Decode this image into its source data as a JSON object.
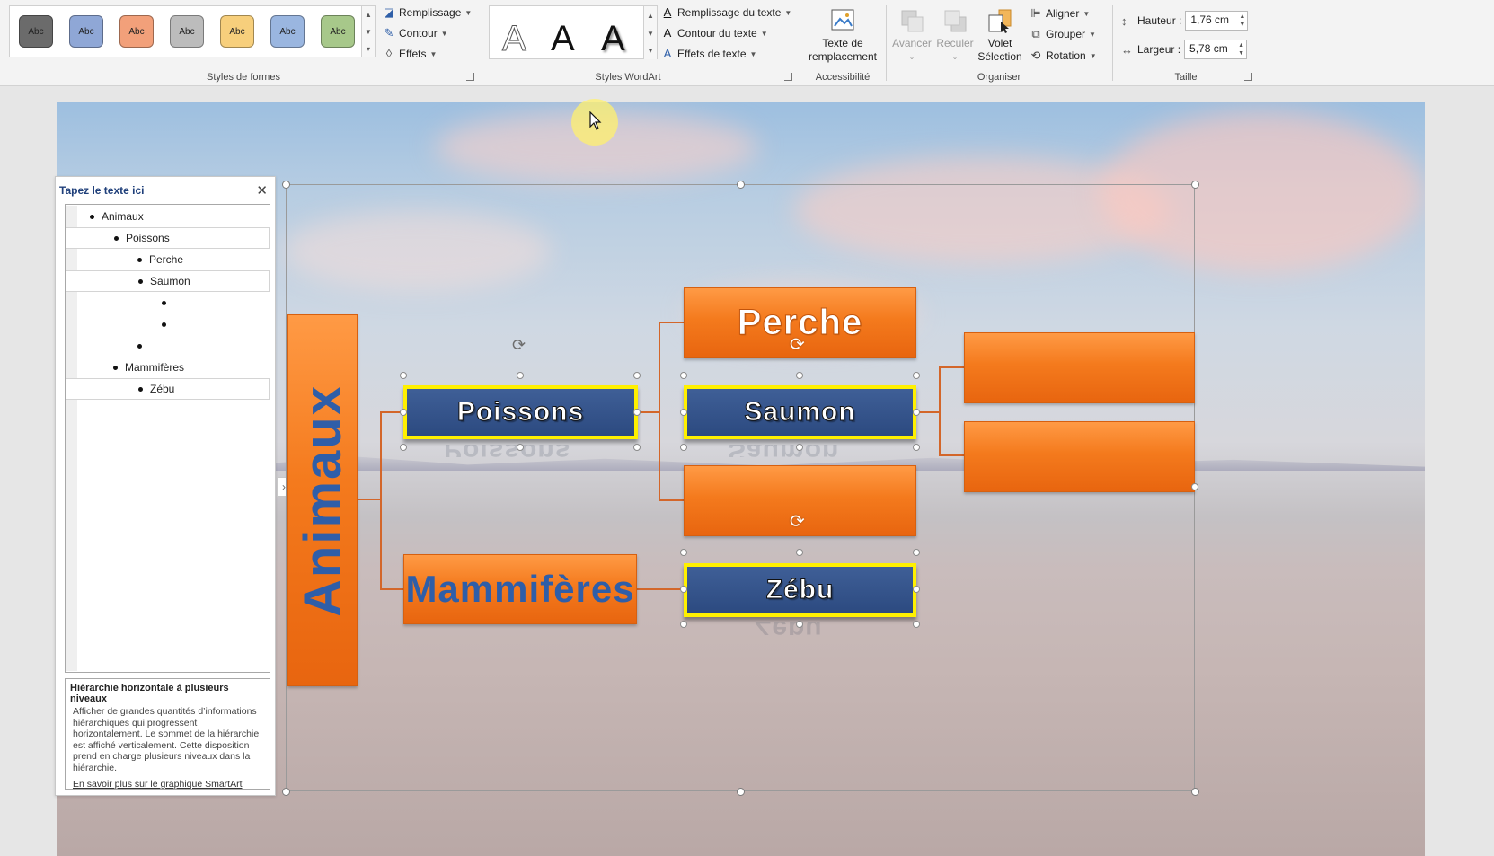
{
  "ribbon": {
    "shape_styles": {
      "label": "Styles de formes",
      "swatches": [
        {
          "text": "Abc",
          "color": "#6b6b6b"
        },
        {
          "text": "Abc",
          "color": "#8fa7d6"
        },
        {
          "text": "Abc",
          "color": "#f2a07a"
        },
        {
          "text": "Abc",
          "color": "#bcbcbc"
        },
        {
          "text": "Abc",
          "color": "#f7cf7c"
        },
        {
          "text": "Abc",
          "color": "#9ab6e0"
        },
        {
          "text": "Abc",
          "color": "#a7c88a"
        }
      ],
      "fill": "Remplissage",
      "outline": "Contour",
      "effects": "Effets"
    },
    "wordart": {
      "label": "Styles WordArt",
      "sample": "A",
      "text_fill": "Remplissage du texte",
      "text_outline": "Contour du texte",
      "text_effects": "Effets de texte"
    },
    "accessibility": {
      "label": "Accessibilité",
      "alt_text_line1": "Texte de",
      "alt_text_line2": "remplacement"
    },
    "arrange": {
      "label": "Organiser",
      "forward": "Avancer",
      "backward": "Reculer",
      "pane_line1": "Volet",
      "pane_line2": "Sélection",
      "align": "Aligner",
      "group": "Grouper",
      "rotate": "Rotation"
    },
    "size": {
      "label": "Taille",
      "height_label": "Hauteur :",
      "height_value": "1,76 cm",
      "width_label": "Largeur :",
      "width_value": "5,78 cm"
    }
  },
  "text_pane": {
    "title": "Tapez le texte ici",
    "items": [
      {
        "text": "Animaux"
      },
      {
        "text": "Poissons"
      },
      {
        "text": "Perche"
      },
      {
        "text": "Saumon"
      },
      {
        "text": ""
      },
      {
        "text": ""
      },
      {
        "text": ""
      },
      {
        "text": "Mammifères"
      },
      {
        "text": "Zébu"
      }
    ],
    "desc_title": "Hiérarchie horizontale à plusieurs niveaux",
    "desc_body": "Afficher de grandes quantités d’informations hiérarchiques qui progressent horizontalement. Le sommet de la hiérarchie est affiché verticalement. Cette disposition prend en charge plusieurs niveaux dans la hiérarchie.",
    "learn_more": "En savoir plus sur le graphique SmartArt"
  },
  "smartart": {
    "root": "Animaux",
    "level1": [
      "Poissons",
      "Mammifères"
    ],
    "level2": [
      "Perche",
      "Saumon",
      "",
      "Zébu"
    ],
    "level3": [
      "",
      ""
    ]
  }
}
